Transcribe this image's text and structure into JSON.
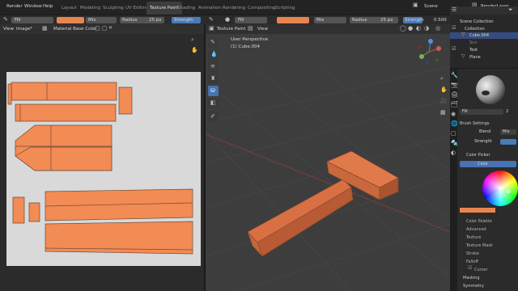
{
  "menu": [
    "Render",
    "Window",
    "Help"
  ],
  "workspaces": [
    "Layout",
    "Modeling",
    "Sculpting",
    "UV Editing",
    "Texture Paint",
    "Shading",
    "Animation",
    "Rendering",
    "Compositing",
    "Scripting"
  ],
  "active_workspace": "Texture Paint",
  "scene": "Scene",
  "view_layer": "RenderLayer",
  "tool_header_left": {
    "brush": "Fill",
    "blend": "Mix",
    "radius_label": "Radius",
    "radius_value": "25 px",
    "strength_label": "Strength"
  },
  "tool_header_right": {
    "brush": "Fill",
    "blend": "Mix",
    "radius_label": "Radius",
    "radius_value": "25 px",
    "strength_label": "Strength",
    "strength_value": "0.500"
  },
  "image_editor": {
    "view_menu": "View",
    "image_menu": "Image*",
    "image_name": "Material Base Color"
  },
  "viewport": {
    "mode": "Texture Paint",
    "view_menu": "View",
    "perspective": "User Perspective",
    "object": "(1) Cube.004"
  },
  "outliner": {
    "items": [
      {
        "label": "Scene Collection"
      },
      {
        "label": "Collection"
      },
      {
        "label": "Cube.004"
      },
      {
        "label": "Sun"
      },
      {
        "label": "Text"
      },
      {
        "label": "Plane"
      }
    ]
  },
  "properties": {
    "brush_name": "Fill",
    "brush_users": "2",
    "brush_settings": "Brush Settings",
    "blend_label": "Blend",
    "blend_value": "Mix",
    "strength_label": "Strength",
    "color_picker": "Color Picker",
    "color_tab": "Color",
    "sections": [
      "Color Palette",
      "Advanced",
      "Texture",
      "Texture Mask",
      "Stroke",
      "Falloff",
      "Cursor"
    ],
    "bottom_sections": [
      "Masking",
      "Symmetry"
    ]
  },
  "colors": {
    "paint": "#e8844e",
    "accent": "#4772b3",
    "active_row": "#334d80"
  }
}
